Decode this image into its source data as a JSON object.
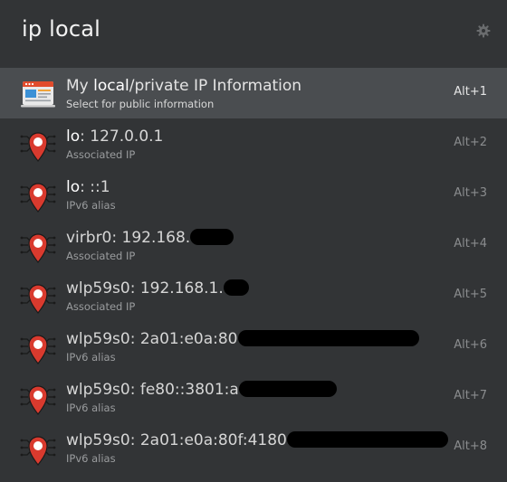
{
  "search": {
    "query": "ip local"
  },
  "colors": {
    "background": "#323436",
    "selected_row": "#4a4d50",
    "pin_red": "#d93a2e"
  },
  "results": [
    {
      "prefix": "My ",
      "highlight": "local",
      "rest": "/private IP Information",
      "subtitle": "Select for public information",
      "shortcut": "Alt+1",
      "icon": "browser-window-icon",
      "selected": true
    },
    {
      "highlight": "lo",
      "rest": ": 127.0.0.1",
      "subtitle": "Associated IP",
      "shortcut": "Alt+2",
      "icon": "network-pin-icon"
    },
    {
      "highlight": "lo",
      "rest": ": ::1",
      "subtitle": "IPv6 alias",
      "shortcut": "Alt+3",
      "icon": "network-pin-icon"
    },
    {
      "rest": "virbr0: 192.168.",
      "subtitle": "Associated IP",
      "shortcut": "Alt+4",
      "icon": "network-pin-icon"
    },
    {
      "rest": "wlp59s0: 192.168.1.",
      "subtitle": "Associated IP",
      "shortcut": "Alt+5",
      "icon": "network-pin-icon"
    },
    {
      "rest": "wlp59s0: 2a01:e0a:80",
      "subtitle": "IPv6 alias",
      "shortcut": "Alt+6",
      "icon": "network-pin-icon"
    },
    {
      "rest": "wlp59s0: fe80::3801:a",
      "subtitle": "IPv6 alias",
      "shortcut": "Alt+7",
      "icon": "network-pin-icon"
    },
    {
      "rest": "wlp59s0: 2a01:e0a:80f:4180",
      "subtitle": "IPv6 alias",
      "shortcut": "Alt+8",
      "icon": "network-pin-icon"
    }
  ]
}
